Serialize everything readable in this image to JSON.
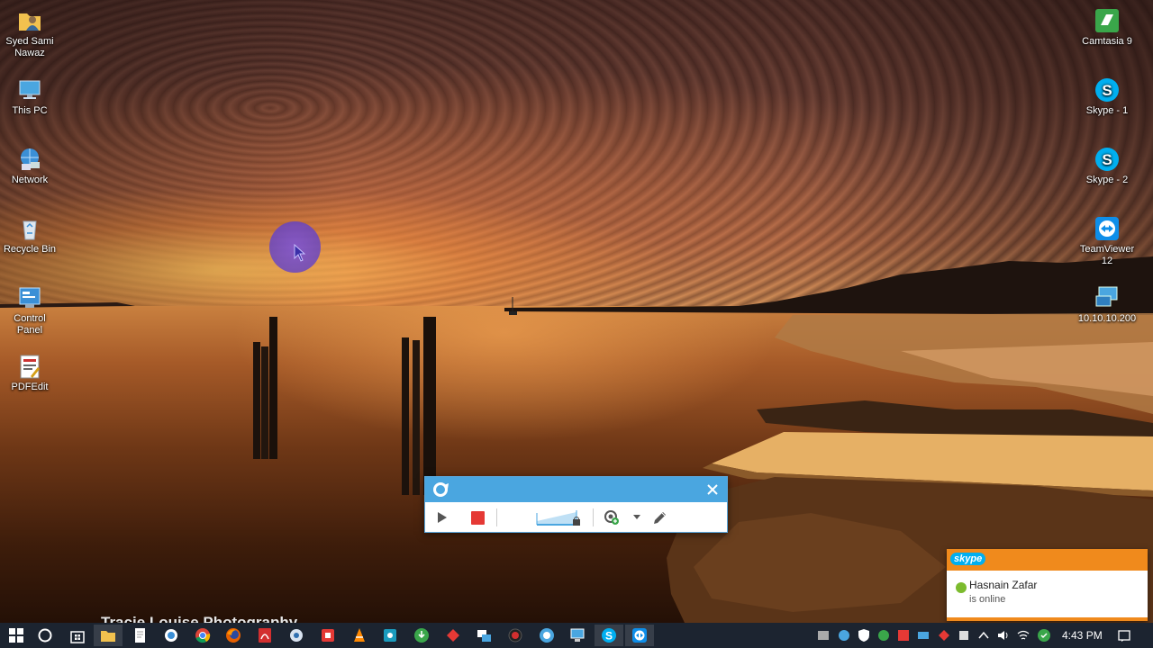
{
  "desktop": {
    "left_icons": [
      {
        "label_line1": "Syed Sami",
        "label_line2": "Nawaz",
        "icon": "user-folder-icon"
      },
      {
        "label_line1": "This PC",
        "label_line2": "",
        "icon": "computer-icon"
      },
      {
        "label_line1": "Network",
        "label_line2": "",
        "icon": "network-icon"
      },
      {
        "label_line1": "Recycle Bin",
        "label_line2": "",
        "icon": "recycle-bin-icon"
      },
      {
        "label_line1": "Control",
        "label_line2": "Panel",
        "icon": "control-panel-icon"
      },
      {
        "label_line1": "PDFEdit",
        "label_line2": "",
        "icon": "pdfedit-icon"
      }
    ],
    "right_icons": [
      {
        "label_line1": "Camtasia 9",
        "label_line2": "",
        "icon": "camtasia-icon"
      },
      {
        "label_line1": "Skype - 1",
        "label_line2": "",
        "icon": "skype-icon"
      },
      {
        "label_line1": "Skype - 2",
        "label_line2": "",
        "icon": "skype-icon"
      },
      {
        "label_line1": "TeamViewer",
        "label_line2": "12",
        "icon": "teamviewer-icon"
      },
      {
        "label_line1": "10.10.10.200",
        "label_line2": "",
        "icon": "remote-desktop-icon"
      }
    ],
    "watermark": "Tracie Louise Photography"
  },
  "recorder": {
    "play_icon": "play-icon",
    "stop_icon": "stop-icon",
    "audio_meter_icon": "audio-level-icon",
    "webcam_icon": "webcam-icon",
    "pen_icon": "pen-icon",
    "accent": "#4aa6e0",
    "stop_color": "#e53935"
  },
  "skype_toast": {
    "brand": "skype",
    "name": "Hasnain Zafar",
    "status": "is online",
    "accent": "#f08a1c"
  },
  "taskbar": {
    "clock": "4:43 PM",
    "pinned": [
      "windows-start-icon",
      "cortana-icon",
      "store-icon",
      "file-explorer-icon",
      "notepad-icon",
      "app-icon",
      "chrome-icon",
      "firefox-icon",
      "acrobat-icon",
      "app-icon",
      "vlc-icon",
      "app-icon",
      "app-icon",
      "app-icon",
      "app-icon",
      "recorder-icon",
      "camtasia-recorder-icon",
      "app-icon",
      "skype-icon",
      "teamviewer-icon"
    ]
  }
}
